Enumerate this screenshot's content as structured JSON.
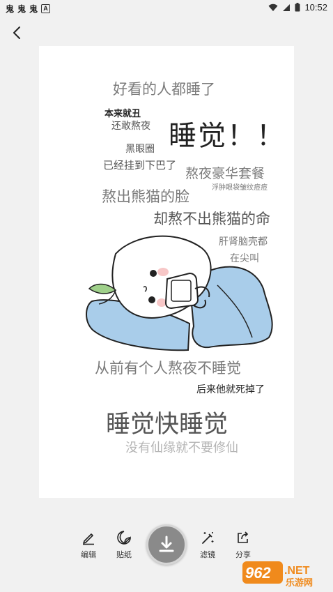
{
  "status_bar": {
    "time": "10:52",
    "left_icons": [
      "鬼",
      "鬼",
      "鬼"
    ],
    "a_icon": "A"
  },
  "meme": {
    "lines": [
      "好看的人都睡了",
      "本来就丑",
      "还敢熬夜",
      "睡觉！！",
      "黑眼圈",
      "已经挂到下巴了",
      "熬夜豪华套餐",
      "浮肿眼袋皱纹痘痘",
      "熬出熊猫的脸",
      "却熬不出熊猫的命",
      "肝肾脑壳都",
      "在尖叫",
      "从前有个人熬夜不睡觉",
      "后来他就死掉了",
      "睡觉快睡觉",
      "没有仙缘就不要修仙"
    ]
  },
  "toolbar": {
    "edit_label": "编辑",
    "sticker_label": "贴纸",
    "filter_label": "滤镜",
    "share_label": "分享"
  },
  "watermark": {
    "brand": "962.NET",
    "site": "乐游网"
  },
  "colors": {
    "accent_orange": "#f08a1c",
    "pillow_blue": "#a9cdea",
    "blush": "#f7c7c7"
  }
}
